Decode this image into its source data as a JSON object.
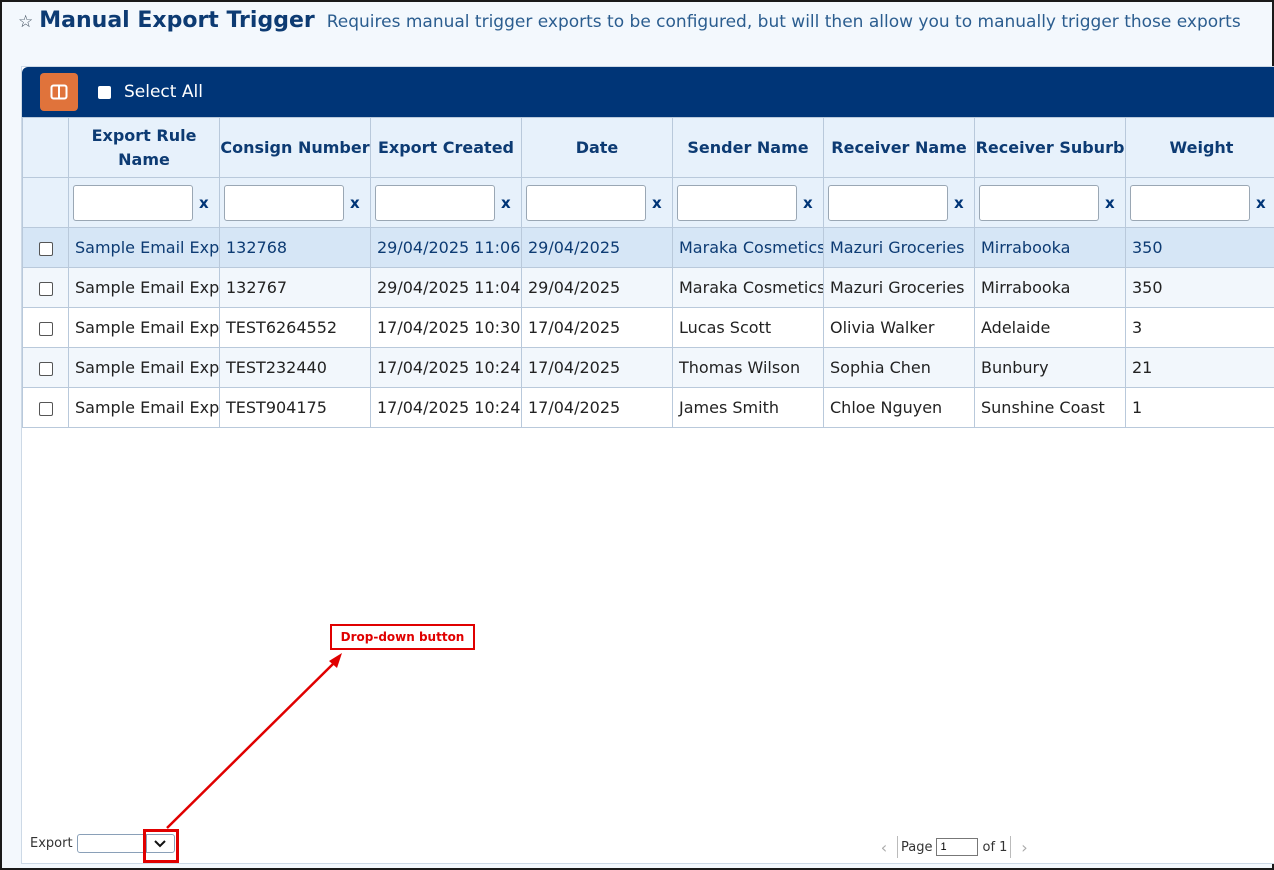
{
  "header": {
    "title": "Manual Export Trigger",
    "subtitle": "Requires manual trigger exports to be configured, but will then allow you to manually trigger those exports"
  },
  "toolbar": {
    "select_all_label": "Select All"
  },
  "table": {
    "columns": [
      "Export Rule Name",
      "Consign Number",
      "Export Created",
      "Date",
      "Sender Name",
      "Receiver Name",
      "Receiver Suburb",
      "Weight"
    ],
    "clear_label": "x",
    "rows": [
      [
        "Sample Email Exp",
        "132768",
        "29/04/2025 11:06",
        "29/04/2025",
        "Maraka Cosmetics",
        "Mazuri Groceries",
        "Mirrabooka",
        "350"
      ],
      [
        "Sample Email Exp",
        "132767",
        "29/04/2025 11:04",
        "29/04/2025",
        "Maraka Cosmetics",
        "Mazuri Groceries",
        "Mirrabooka",
        "350"
      ],
      [
        "Sample Email Exp",
        "TEST6264552",
        "17/04/2025 10:30",
        "17/04/2025",
        "Lucas Scott",
        "Olivia Walker",
        "Adelaide",
        "3"
      ],
      [
        "Sample Email Exp",
        "TEST232440",
        "17/04/2025 10:24",
        "17/04/2025",
        "Thomas Wilson",
        "Sophia Chen",
        "Bunbury",
        "21"
      ],
      [
        "Sample Email Exp",
        "TEST904175",
        "17/04/2025 10:24",
        "17/04/2025",
        "James Smith",
        "Chloe Nguyen",
        "Sunshine Coast",
        "1"
      ]
    ]
  },
  "footer": {
    "export_label": "Export",
    "page_label": "Page",
    "page_value": "1",
    "of_label": "of 1"
  },
  "annotation": {
    "label": "Drop-down button"
  },
  "colors": {
    "toolbar": "#003577",
    "accent": "#e0733b",
    "annotation": "#e00000"
  }
}
